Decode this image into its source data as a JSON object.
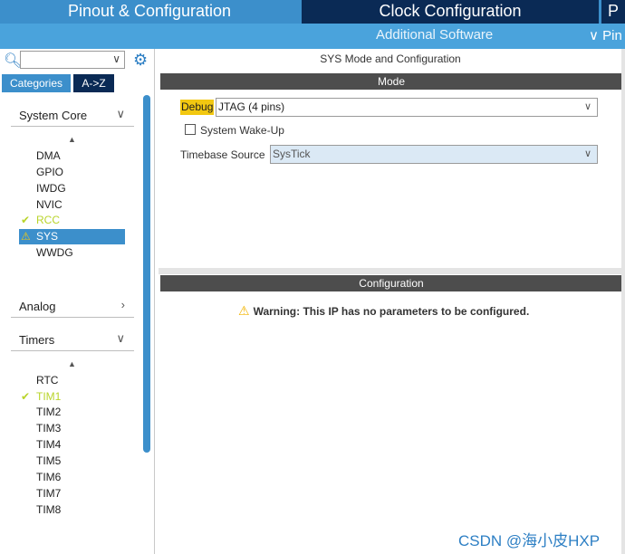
{
  "tabs": {
    "pinout": "Pinout & Configuration",
    "clock": "Clock Configuration",
    "more": "P"
  },
  "subbar": {
    "additional_software": "Additional Software",
    "pinout_menu": "∨ Pin"
  },
  "left_panel": {
    "search_value": "",
    "categories_label": "Categories",
    "az_label": "A->Z",
    "system_core": {
      "label": "System Core",
      "items": [
        {
          "name": "DMA",
          "status": "none"
        },
        {
          "name": "GPIO",
          "status": "none"
        },
        {
          "name": "IWDG",
          "status": "none"
        },
        {
          "name": "NVIC",
          "status": "none"
        },
        {
          "name": "RCC",
          "status": "ok"
        },
        {
          "name": "SYS",
          "status": "warning"
        },
        {
          "name": "WWDG",
          "status": "none"
        }
      ]
    },
    "analog": {
      "label": "Analog"
    },
    "timers": {
      "label": "Timers",
      "items": [
        {
          "name": "RTC",
          "status": "none"
        },
        {
          "name": "TIM1",
          "status": "ok"
        },
        {
          "name": "TIM2",
          "status": "none"
        },
        {
          "name": "TIM3",
          "status": "none"
        },
        {
          "name": "TIM4",
          "status": "none"
        },
        {
          "name": "TIM5",
          "status": "none"
        },
        {
          "name": "TIM6",
          "status": "none"
        },
        {
          "name": "TIM7",
          "status": "none"
        },
        {
          "name": "TIM8",
          "status": "none"
        }
      ]
    }
  },
  "main": {
    "title": "SYS Mode and Configuration",
    "mode_header": "Mode",
    "debug_label": "Debug",
    "debug_value": "JTAG (4 pins)",
    "wake_label": "System Wake-Up",
    "wake_checked": false,
    "timebase_label": "Timebase Source",
    "timebase_value": "SysTick",
    "config_header": "Configuration",
    "warning_text": "Warning: This IP has no parameters to be configured."
  },
  "watermark": "CSDN @海小皮HXP",
  "colors": {
    "accent_blue": "#3c8fcb",
    "dark_navy": "#0a2a55",
    "ok_green": "#b9d42a",
    "warn_yellow": "#f2c811",
    "header_gray": "#4d4d4d"
  }
}
